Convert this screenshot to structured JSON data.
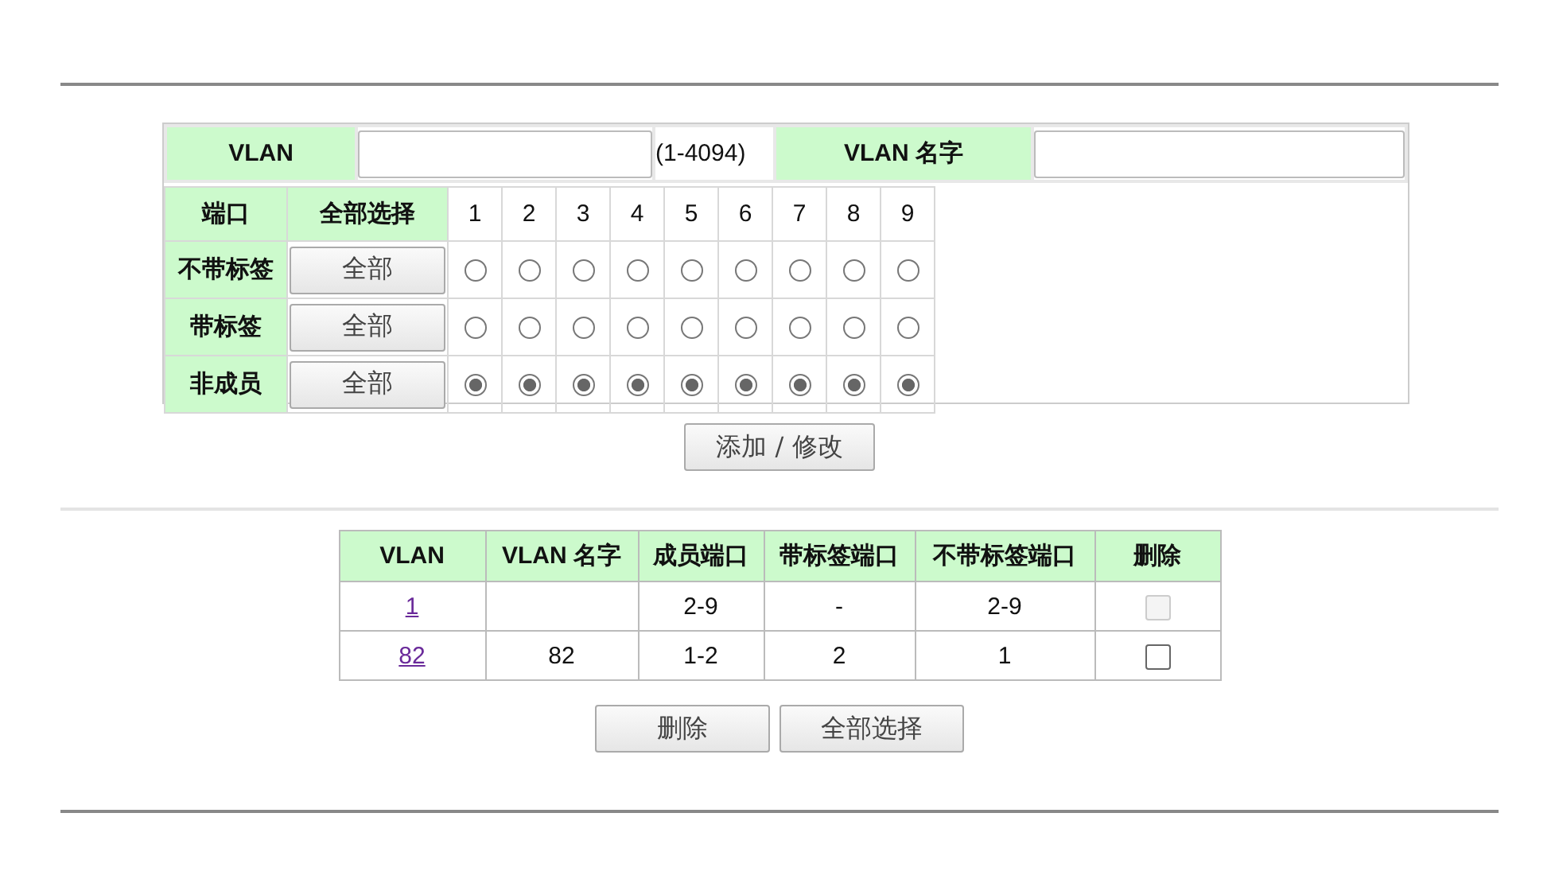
{
  "form": {
    "vlan_label": "VLAN",
    "range_hint": "(1-4094)",
    "name_label": "VLAN 名字",
    "port_header": "端口",
    "select_all_header": "全部选择",
    "ports": [
      "1",
      "2",
      "3",
      "4",
      "5",
      "6",
      "7",
      "8",
      "9"
    ],
    "rows": [
      {
        "label": "不带标签",
        "button": "全部",
        "radios": [
          {
            "selected": false
          },
          {
            "selected": false
          },
          {
            "selected": false
          },
          {
            "selected": false
          },
          {
            "selected": false
          },
          {
            "selected": false
          },
          {
            "selected": false
          },
          {
            "selected": false
          },
          {
            "selected": false
          }
        ]
      },
      {
        "label": "带标签",
        "button": "全部",
        "radios": [
          {
            "selected": false
          },
          {
            "selected": false
          },
          {
            "selected": false
          },
          {
            "selected": false
          },
          {
            "selected": false
          },
          {
            "selected": false
          },
          {
            "selected": false
          },
          {
            "selected": false
          },
          {
            "selected": false
          }
        ]
      },
      {
        "label": "非成员",
        "button": "全部",
        "radios": [
          {
            "selected": true
          },
          {
            "selected": true
          },
          {
            "selected": true
          },
          {
            "selected": true
          },
          {
            "selected": true
          },
          {
            "selected": true
          },
          {
            "selected": true
          },
          {
            "selected": true
          },
          {
            "selected": true
          }
        ]
      }
    ],
    "submit_button": "添加 / 修改"
  },
  "table": {
    "columns": [
      "VLAN",
      "VLAN 名字",
      "成员端口",
      "带标签端口",
      "不带标签端口",
      "删除"
    ],
    "rows": [
      {
        "vlan": "1",
        "name": "",
        "members": "2-9",
        "tagged": "-",
        "untagged": "2-9",
        "delete": {
          "checked": false,
          "disabled": true
        }
      },
      {
        "vlan": "82",
        "name": "82",
        "members": "1-2",
        "tagged": "2",
        "untagged": "1",
        "delete": {
          "checked": false,
          "disabled": false
        }
      }
    ]
  },
  "buttons": [
    "删除",
    "全部选择"
  ]
}
